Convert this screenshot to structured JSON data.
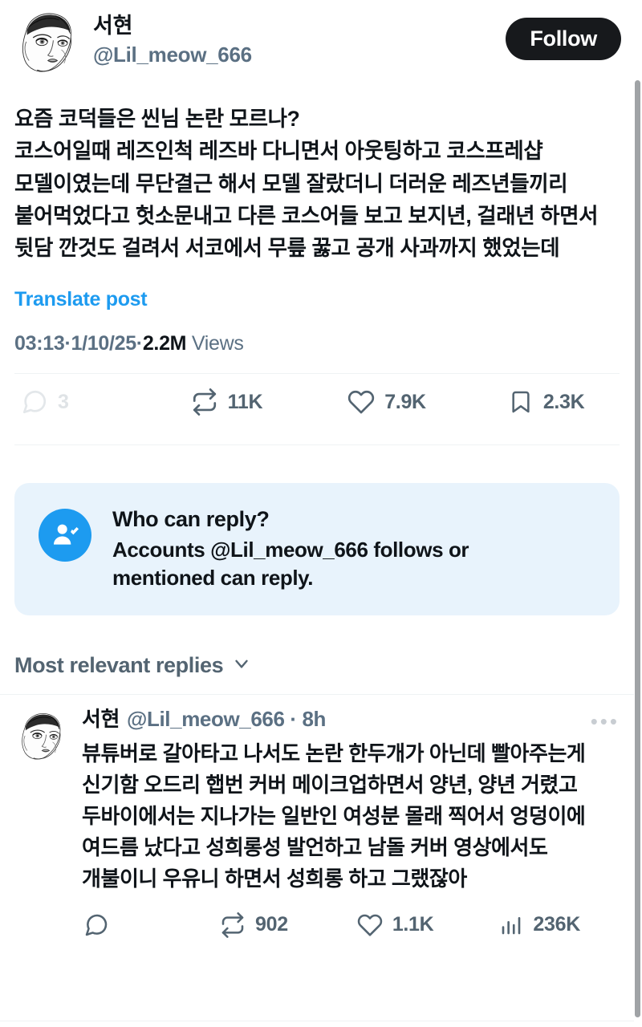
{
  "post": {
    "author": {
      "display_name": "서현",
      "handle": "@Lil_meow_666",
      "avatar_alt": "line-art-portrait"
    },
    "follow_label": "Follow",
    "text": "요즘 코덕들은 씬님 논란 모르나?\n코스어일때 레즈인척 레즈바 다니면서 아웃팅하고 코스프레샵 모델이였는데 무단결근 해서 모델 잘랐더니 더러운 레즈년들끼리 붙어먹었다고 헛소문내고 다른 코스어들 보고 보지년, 걸래년 하면서 뒷담 깐것도 걸려서 서코에서 무릎 꿇고 공개 사과까지 했었는데",
    "translate_label": "Translate post",
    "meta": {
      "time": "03:13",
      "date": "1/10/25",
      "views_count": "2.2M",
      "views_word": "Views",
      "separator": "·"
    },
    "actions": {
      "reply_count": "3",
      "retweet_count": "11K",
      "like_count": "7.9K",
      "bookmark_count": "2.3K",
      "share_count": ""
    }
  },
  "reply_policy": {
    "title": "Who can reply?",
    "description": "Accounts @Lil_meow_666 follows or mentioned can reply."
  },
  "sort": {
    "label": "Most relevant replies"
  },
  "replies": [
    {
      "display_name": "서현",
      "handle": "@Lil_meow_666",
      "separator": "·",
      "timestamp": "8h",
      "more_label": "•••",
      "text": "뷰튜버로 갈아타고 나서도 논란 한두개가 아닌데 빨아주는게 신기함 오드리 햅번 커버 메이크업하면서 양년, 양년 거렸고 두바이에서는 지나가는 일반인 여성분 몰래 찍어서 엉덩이에 여드름 났다고 성희롱성 발언하고 남돌 커버 영상에서도 개불이니 우유니 하면서 성희롱 하고 그랬잖아",
      "actions": {
        "reply_count": "",
        "retweet_count": "902",
        "like_count": "1.1K",
        "views_count": "236K",
        "bookmark_count": "",
        "share_count": ""
      }
    }
  ],
  "colors": {
    "accent_blue": "#1d9bf0",
    "text_primary": "#0f1419",
    "text_secondary": "#5b7083",
    "icon_gray": "#536471",
    "follow_bg": "#17191c",
    "policy_bg": "#e8f3fc",
    "divider": "#eff3f4",
    "muted": "#dfe3e6"
  }
}
